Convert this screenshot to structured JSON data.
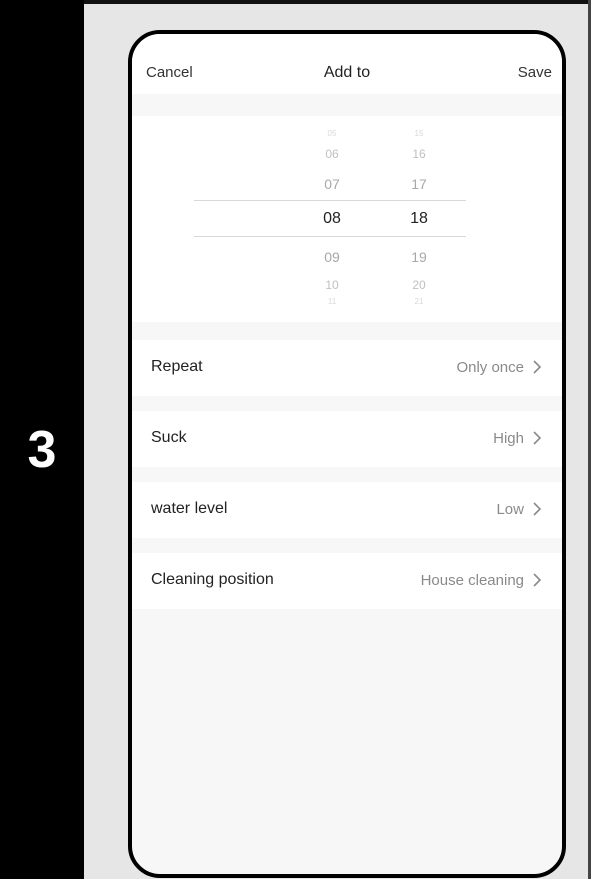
{
  "step": {
    "number": "3"
  },
  "nav": {
    "cancel": "Cancel",
    "title": "Add to",
    "save": "Save"
  },
  "picker": {
    "hours": [
      "05",
      "06",
      "07",
      "08",
      "09",
      "10",
      "11"
    ],
    "minutes": [
      "15",
      "16",
      "17",
      "18",
      "19",
      "20",
      "21"
    ],
    "selected_hour": "08",
    "selected_minute": "18"
  },
  "settings": [
    {
      "label": "Repeat",
      "value": "Only once"
    },
    {
      "label": "Suck",
      "value": "High"
    },
    {
      "label": "water level",
      "value": "Low"
    },
    {
      "label": "Cleaning position",
      "value": "House cleaning"
    }
  ],
  "icons": {
    "chevron": "chevron-right-icon"
  }
}
